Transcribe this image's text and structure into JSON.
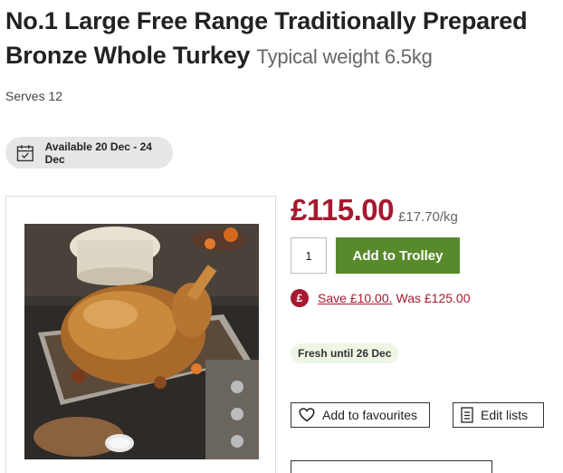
{
  "product": {
    "title": "No.1 Large Free Range Traditionally Prepared Bronze Whole Turkey",
    "typical_weight": "Typical weight 6.5kg",
    "serves": "Serves 12",
    "availability": "Available 20 Dec - 24 Dec",
    "image_alt": "Roast turkey in a roasting tray"
  },
  "pricing": {
    "price": "£115.00",
    "price_per_kg": "£17.70/kg",
    "quantity": "1",
    "add_to_trolley_label": "Add to Trolley",
    "offer_icon": "£",
    "save_text": "Save £10.00.",
    "was_text": "Was £125.00"
  },
  "freshness": {
    "label": "Fresh until 26 Dec"
  },
  "actions": {
    "favourites_label": "Add to favourites",
    "edit_lists_label": "Edit lists"
  },
  "colors": {
    "price": "#a6192e",
    "trolley_button": "#588a2b",
    "fresh_badge_bg": "#eef6e4",
    "availability_bg": "#e6e6e6"
  },
  "icons": {
    "availability": "calendar-icon",
    "favourites": "heart-icon",
    "edit_lists": "list-icon"
  }
}
